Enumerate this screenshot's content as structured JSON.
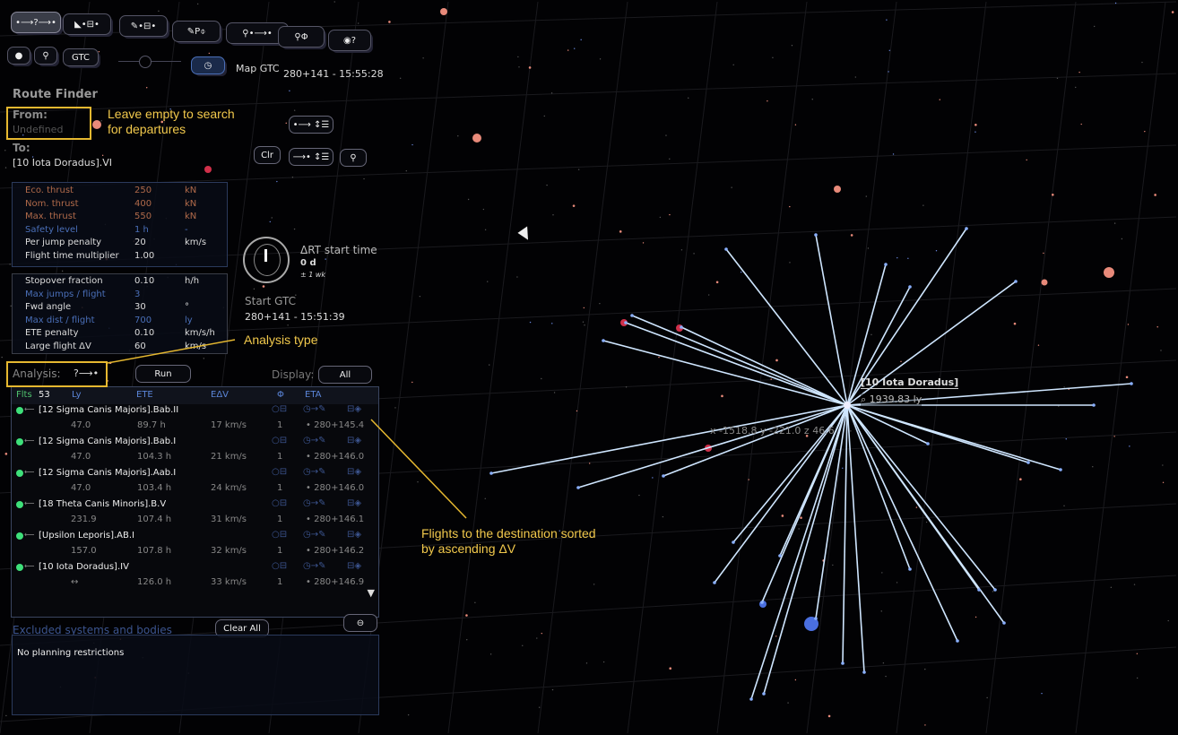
{
  "toolbar": {
    "row1": [
      "•⟶?⟶•",
      "◣•⊟•",
      "✎•⊟•",
      "✎P⌽",
      "⚲•⟶•",
      "⚲Φ",
      "◉?"
    ],
    "dot_btn": "●",
    "search_btn": "⚲",
    "gtc_btn": "GTC",
    "clock_icon": "clock-icon",
    "map_gtc_label": "Map GTC",
    "map_gtc_value": "280+141 - 15:55:28"
  },
  "route": {
    "title": "Route Finder",
    "from_label": "From:",
    "from_value": "Undefined",
    "to_label": "To:",
    "to_value": "[10 Iota Doradus].VI",
    "btn_from_list": "•⟶ ↕☰",
    "btn_clr": "Clr",
    "btn_to_list": "⟶• ↕☰",
    "btn_search": "⚲"
  },
  "params1": [
    {
      "label": "Eco. thrust",
      "value": "250",
      "unit": "kN",
      "c": "orange"
    },
    {
      "label": "Nom. thrust",
      "value": "400",
      "unit": "kN",
      "c": "orange"
    },
    {
      "label": "Max. thrust",
      "value": "550",
      "unit": "kN",
      "c": "orange"
    },
    {
      "label": "Safety level",
      "value": "1 h",
      "unit": "-",
      "c": "blue"
    },
    {
      "label": "Per jump penalty",
      "value": "20",
      "unit": "km/s",
      "c": ""
    },
    {
      "label": "Flight time multiplier",
      "value": "1.00",
      "unit": "",
      "c": ""
    }
  ],
  "params2": [
    {
      "label": "Stopover fraction",
      "value": "0.10",
      "unit": "h/h",
      "c": ""
    },
    {
      "label": "Max jumps / flight",
      "value": "3",
      "unit": "",
      "c": "blue"
    },
    {
      "label": "Fwd angle",
      "value": "30",
      "unit": "°",
      "c": ""
    },
    {
      "label": "Max dist / flight",
      "value": "700",
      "unit": "ly",
      "c": "blue"
    },
    {
      "label": "ETE penalty",
      "value": "0.10",
      "unit": "km/s/h",
      "c": ""
    },
    {
      "label": "Large flight ΔV",
      "value": "60",
      "unit": "km/s",
      "c": ""
    }
  ],
  "timer": {
    "label": "ΔRT start time",
    "value": "0 d",
    "range": "± 1 wk",
    "start_label": "Start GTC",
    "start_value": "280+141 - 15:51:39"
  },
  "analysis": {
    "label": "Analysis:",
    "value": "?⟶•",
    "run": "Run",
    "display_label": "Display:",
    "display_value": "All"
  },
  "list": {
    "headers": {
      "flts": "Flts",
      "count": "53",
      "ly": "Ly",
      "ete": "ETE",
      "edv": "EΔV",
      "phi": "Φ",
      "eta": "ETA"
    },
    "rows": [
      {
        "name": "[12 Sigma Canis Majoris].Bab.II",
        "ly": "47.0",
        "ete": "89.7 h",
        "edv": "17 km/s",
        "phi": "1",
        "eta": "• 280+145.4"
      },
      {
        "name": "[12 Sigma Canis Majoris].Bab.I",
        "ly": "47.0",
        "ete": "104.3 h",
        "edv": "21 km/s",
        "phi": "1",
        "eta": "• 280+146.0"
      },
      {
        "name": "[12 Sigma Canis Majoris].Aab.I",
        "ly": "47.0",
        "ete": "103.4 h",
        "edv": "24 km/s",
        "phi": "1",
        "eta": "• 280+146.0"
      },
      {
        "name": "[18 Theta Canis Minoris].B.V",
        "ly": "231.9",
        "ete": "107.4 h",
        "edv": "31 km/s",
        "phi": "1",
        "eta": "• 280+146.1"
      },
      {
        "name": "[Upsilon Leporis].AB.I",
        "ly": "157.0",
        "ete": "107.8 h",
        "edv": "32 km/s",
        "phi": "1",
        "eta": "• 280+146.2"
      },
      {
        "name": "[10 Iota Doradus].IV",
        "ly": "↔",
        "ete": "126.0 h",
        "edv": "33 km/s",
        "phi": "1",
        "eta": "• 280+146.9"
      }
    ],
    "row_icons": {
      "a": "○⊟",
      "b": "◷→✎",
      "c": "⊟◈"
    },
    "scroll_down": "▼"
  },
  "excluded": {
    "title": "Excluded systems and bodies",
    "clear": "Clear All",
    "minus": "⊖",
    "text": "No planning restrictions"
  },
  "map": {
    "target": "[10 Iota Doradus]",
    "distance": "⌕ 1939.83 ly",
    "coords": "x -1518.8  y -221.0  z 46.6"
  },
  "annotations": {
    "from": "Leave empty to search\nfor departures",
    "analysis": "Analysis type",
    "flights": "Flights to the destination sorted\nby ascending ΔV"
  },
  "colors": {
    "accent": "#f2c94c",
    "line": "#cfe6ff",
    "green": "#3ee07a"
  }
}
